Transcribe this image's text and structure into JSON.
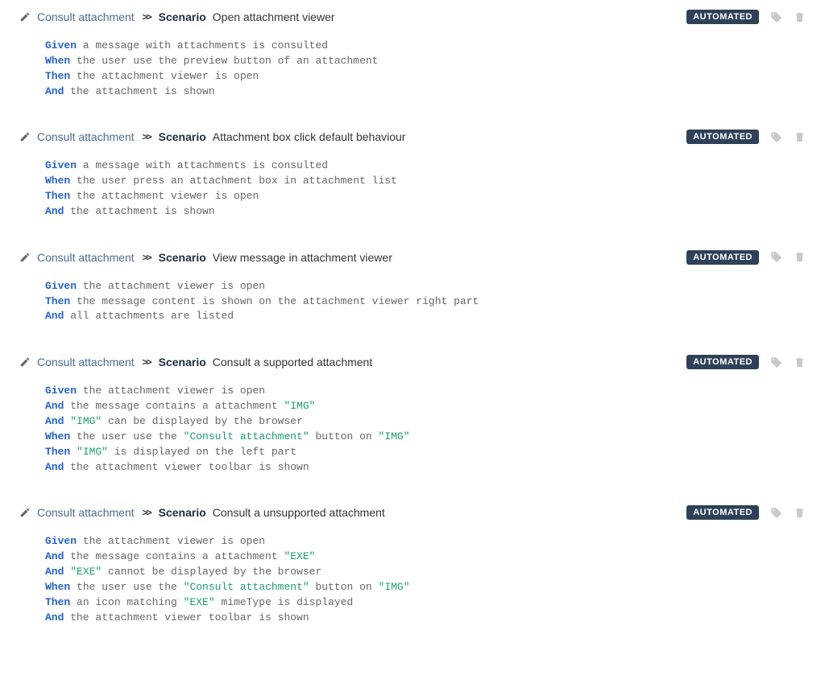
{
  "labels": {
    "feature_link": "Consult attachment",
    "scenario_word": "Scenario"
  },
  "badge": "AUTOMATED",
  "scenarios": [
    {
      "title": "Open attachment viewer",
      "steps": [
        {
          "keyword": "Given",
          "tokens": [
            {
              "t": "txt",
              "v": " a message with attachments is consulted"
            }
          ]
        },
        {
          "keyword": "When",
          "tokens": [
            {
              "t": "txt",
              "v": " the user use the preview button of an attachment"
            }
          ]
        },
        {
          "keyword": "Then",
          "tokens": [
            {
              "t": "txt",
              "v": " the attachment viewer is open"
            }
          ]
        },
        {
          "keyword": "And",
          "tokens": [
            {
              "t": "txt",
              "v": " the attachment is shown"
            }
          ]
        }
      ]
    },
    {
      "title": "Attachment box click default behaviour",
      "steps": [
        {
          "keyword": "Given",
          "tokens": [
            {
              "t": "txt",
              "v": " a message with attachments is consulted"
            }
          ]
        },
        {
          "keyword": "When",
          "tokens": [
            {
              "t": "txt",
              "v": " the user press an attachment box in attachment list"
            }
          ]
        },
        {
          "keyword": "Then",
          "tokens": [
            {
              "t": "txt",
              "v": " the attachment viewer is open"
            }
          ]
        },
        {
          "keyword": "And",
          "tokens": [
            {
              "t": "txt",
              "v": " the attachment is shown"
            }
          ]
        }
      ]
    },
    {
      "title": "View message in attachment viewer",
      "steps": [
        {
          "keyword": "Given",
          "tokens": [
            {
              "t": "txt",
              "v": " the attachment viewer is open"
            }
          ]
        },
        {
          "keyword": "Then",
          "tokens": [
            {
              "t": "txt",
              "v": " the message content is shown on the attachment viewer right part"
            }
          ]
        },
        {
          "keyword": "And",
          "tokens": [
            {
              "t": "txt",
              "v": " all attachments are listed"
            }
          ]
        }
      ]
    },
    {
      "title": "Consult a supported attachment",
      "steps": [
        {
          "keyword": "Given",
          "tokens": [
            {
              "t": "txt",
              "v": " the attachment viewer is open"
            }
          ]
        },
        {
          "keyword": "And",
          "tokens": [
            {
              "t": "txt",
              "v": " the message contains a attachment "
            },
            {
              "t": "str",
              "v": "\"IMG\""
            }
          ]
        },
        {
          "keyword": "And",
          "tokens": [
            {
              "t": "txt",
              "v": " "
            },
            {
              "t": "str",
              "v": "\"IMG\""
            },
            {
              "t": "txt",
              "v": " can be displayed by the browser"
            }
          ]
        },
        {
          "keyword": "When",
          "tokens": [
            {
              "t": "txt",
              "v": " the user use the "
            },
            {
              "t": "str",
              "v": "\"Consult attachment\""
            },
            {
              "t": "txt",
              "v": " button on "
            },
            {
              "t": "str",
              "v": "\"IMG\""
            }
          ]
        },
        {
          "keyword": "Then",
          "tokens": [
            {
              "t": "txt",
              "v": " "
            },
            {
              "t": "str",
              "v": "\"IMG\""
            },
            {
              "t": "txt",
              "v": " is displayed on the left part"
            }
          ]
        },
        {
          "keyword": "And",
          "tokens": [
            {
              "t": "txt",
              "v": " the attachment viewer toolbar is shown"
            }
          ]
        }
      ]
    },
    {
      "title": "Consult a unsupported attachment",
      "steps": [
        {
          "keyword": "Given",
          "tokens": [
            {
              "t": "txt",
              "v": " the attachment viewer is open"
            }
          ]
        },
        {
          "keyword": "And",
          "tokens": [
            {
              "t": "txt",
              "v": " the message contains a attachment "
            },
            {
              "t": "str",
              "v": "\"EXE\""
            }
          ]
        },
        {
          "keyword": "And",
          "tokens": [
            {
              "t": "txt",
              "v": " "
            },
            {
              "t": "str",
              "v": "\"EXE\""
            },
            {
              "t": "txt",
              "v": " cannot be displayed by the browser"
            }
          ]
        },
        {
          "keyword": "When",
          "tokens": [
            {
              "t": "txt",
              "v": " the user use the "
            },
            {
              "t": "str",
              "v": "\"Consult attachment\""
            },
            {
              "t": "txt",
              "v": " button on "
            },
            {
              "t": "str",
              "v": "\"IMG\""
            }
          ]
        },
        {
          "keyword": "Then",
          "tokens": [
            {
              "t": "txt",
              "v": " an icon matching "
            },
            {
              "t": "str",
              "v": "\"EXE\""
            },
            {
              "t": "txt",
              "v": " mimeType is displayed"
            }
          ]
        },
        {
          "keyword": "And",
          "tokens": [
            {
              "t": "txt",
              "v": " the attachment viewer toolbar is shown"
            }
          ]
        }
      ]
    }
  ]
}
